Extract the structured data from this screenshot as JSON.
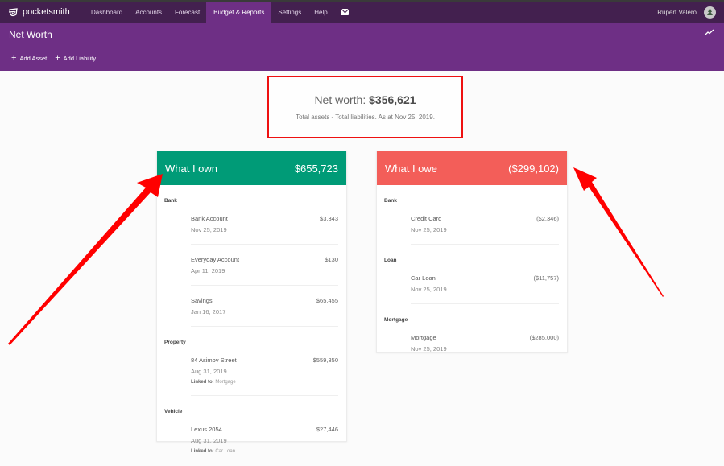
{
  "app": {
    "name": "pocketsmith",
    "logo_icon": "pocketsmith-logo-icon"
  },
  "nav": {
    "items": [
      {
        "label": "Dashboard",
        "active": false
      },
      {
        "label": "Accounts",
        "active": false
      },
      {
        "label": "Forecast",
        "active": false
      },
      {
        "label": "Budget & Reports",
        "active": true
      },
      {
        "label": "Settings",
        "active": false
      },
      {
        "label": "Help",
        "active": false
      }
    ],
    "mail_icon": "envelope-icon",
    "user_name": "Rupert Valero",
    "avatar_icon": "user-avatar-icon"
  },
  "header": {
    "title": "Net Worth",
    "trend_icon": "trend-chart-icon",
    "actions": [
      {
        "label": "Add Asset",
        "icon": "plus-icon"
      },
      {
        "label": "Add Liability",
        "icon": "plus-icon"
      }
    ]
  },
  "summary": {
    "label": "Net worth:",
    "value": "$356,621",
    "subtitle": "Total assets - Total liabilities. As at Nov 25, 2019."
  },
  "assets": {
    "title": "What I own",
    "total": "$655,723",
    "color": "#009b77",
    "groups": [
      {
        "label": "Bank",
        "items": [
          {
            "name": "Bank Account",
            "date": "Nov 25, 2019",
            "value": "$3,343"
          },
          {
            "name": "Everyday Account",
            "date": "Apr 11, 2019",
            "value": "$130"
          },
          {
            "name": "Savings",
            "date": "Jan 16, 2017",
            "value": "$65,455"
          }
        ]
      },
      {
        "label": "Property",
        "items": [
          {
            "name": "84 Asimov Street",
            "date": "Aug 31, 2019",
            "value": "$559,350",
            "linked_label": "Linked to:",
            "linked_to": "Mortgage"
          }
        ]
      },
      {
        "label": "Vehicle",
        "items": [
          {
            "name": "Lexus 2054",
            "date": "Aug 31, 2019",
            "value": "$27,446",
            "linked_label": "Linked to:",
            "linked_to": "Car Loan"
          }
        ]
      }
    ]
  },
  "liabilities": {
    "title": "What I owe",
    "total": "($299,102)",
    "color": "#f35e59",
    "groups": [
      {
        "label": "Bank",
        "items": [
          {
            "name": "Credit Card",
            "date": "Nov 25, 2019",
            "value": "($2,346)"
          }
        ]
      },
      {
        "label": "Loan",
        "items": [
          {
            "name": "Car Loan",
            "date": "Nov 25, 2019",
            "value": "($11,757)"
          }
        ]
      },
      {
        "label": "Mortgage",
        "items": [
          {
            "name": "Mortgage",
            "date": "Nov 25, 2019",
            "value": "($285,000)"
          }
        ]
      }
    ]
  },
  "annotations": {
    "highlight_color": "#ee1111",
    "arrows": [
      "arrow-to-what-i-own",
      "arrow-to-what-i-owe"
    ]
  }
}
